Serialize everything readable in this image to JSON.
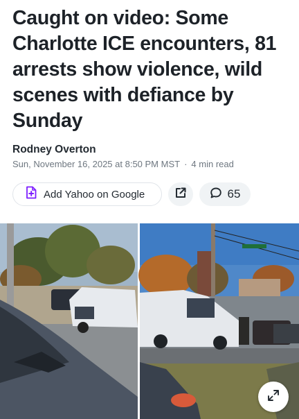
{
  "article": {
    "headline": "Caught on video: Some Charlotte ICE encounters, 81 arrests show violence, wild scenes with defiance by Sunday",
    "author": "Rodney Overton",
    "date": "Sun, November 16, 2025 at 8:50 PM MST",
    "read_time": "4 min read"
  },
  "actions": {
    "add_yahoo_label": "Add Yahoo on Google",
    "add_yahoo_icon": "add-document-icon",
    "share_icon": "share-external-icon",
    "comment_icon": "comment-bubble-icon",
    "comment_count": "65"
  },
  "media": {
    "expand_icon": "expand-icon"
  },
  "colors": {
    "accent": "#7e1fff",
    "headline": "#1d2228",
    "meta": "#6e7780"
  }
}
